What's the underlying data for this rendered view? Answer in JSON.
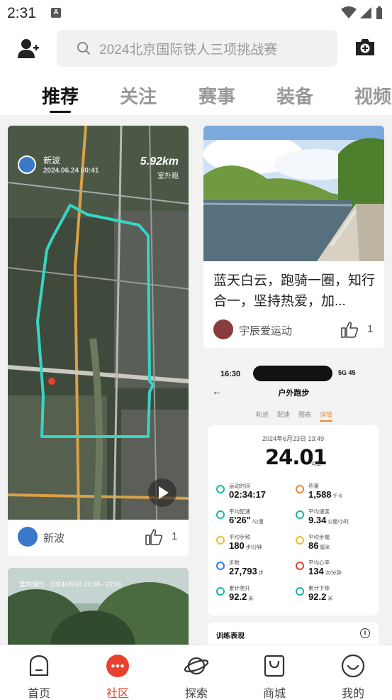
{
  "status_bar": {
    "time": "2:31",
    "badge": "A"
  },
  "search": {
    "placeholder": "2024北京国际铁人三项挑战赛"
  },
  "tabs": [
    {
      "label": "推荐",
      "active": true
    },
    {
      "label": "关注"
    },
    {
      "label": "赛事"
    },
    {
      "label": "装备"
    },
    {
      "label": "视频"
    }
  ],
  "feed": {
    "card1": {
      "map_user": "新波",
      "map_datetime": "2024.06.24 00:41",
      "map_distance": "5.92km",
      "map_activity": "室外跑",
      "author": "新波",
      "likes": "1"
    },
    "card2": {
      "title": "蓝天白云，跑骑一圈，知行合一，坚持热爱，加...",
      "author": "宇辰爱运动",
      "likes": "1"
    },
    "card3": {
      "phone_time": "16:30",
      "phone_status": "5G 45",
      "page_title": "户外跑步",
      "subtabs": [
        "轨迹",
        "配速",
        "图表",
        "详情"
      ],
      "date": "2024年6月23日 13:49",
      "distance": "24.01",
      "distance_unit": "公里",
      "metrics": [
        {
          "label": "运动时间",
          "value": "02:34:17",
          "unit": "",
          "color": "#18b5a6"
        },
        {
          "label": "热量",
          "value": "1,588",
          "unit": "千卡",
          "color": "#f08a2a"
        },
        {
          "label": "平均配速",
          "value": "6'26\"",
          "unit": "/公里",
          "color": "#18b5a6"
        },
        {
          "label": "平均速度",
          "value": "9.34",
          "unit": "公里/小时",
          "color": "#18b5a6"
        },
        {
          "label": "平均步频",
          "value": "180",
          "unit": "步/分钟",
          "color": "#f0b92a"
        },
        {
          "label": "平均步幅",
          "value": "86",
          "unit": "厘米",
          "color": "#f0b92a"
        },
        {
          "label": "步数",
          "value": "27,793",
          "unit": "步",
          "color": "#2a7bf0"
        },
        {
          "label": "平均心率",
          "value": "134",
          "unit": "次/分钟",
          "color": "#e8412e"
        },
        {
          "label": "累计爬升",
          "value": "92.2",
          "unit": "米",
          "color": "#18b5a6"
        },
        {
          "label": "累计下降",
          "value": "92.2",
          "unit": "米",
          "color": "#18b5a6"
        }
      ],
      "footer": "训练表现"
    },
    "card4": {
      "caption": "室内骑行 · 2024/06/24 21:38 - 22:01"
    }
  },
  "bottom_nav": [
    {
      "label": "首页",
      "icon": "home-icon"
    },
    {
      "label": "社区",
      "icon": "community-icon",
      "active": true
    },
    {
      "label": "探索",
      "icon": "explore-icon"
    },
    {
      "label": "商城",
      "icon": "shop-icon"
    },
    {
      "label": "我的",
      "icon": "profile-icon"
    }
  ],
  "colors": {
    "accent": "#e8412e",
    "route": "#35d6c6",
    "highlight": "#f08a2a"
  }
}
